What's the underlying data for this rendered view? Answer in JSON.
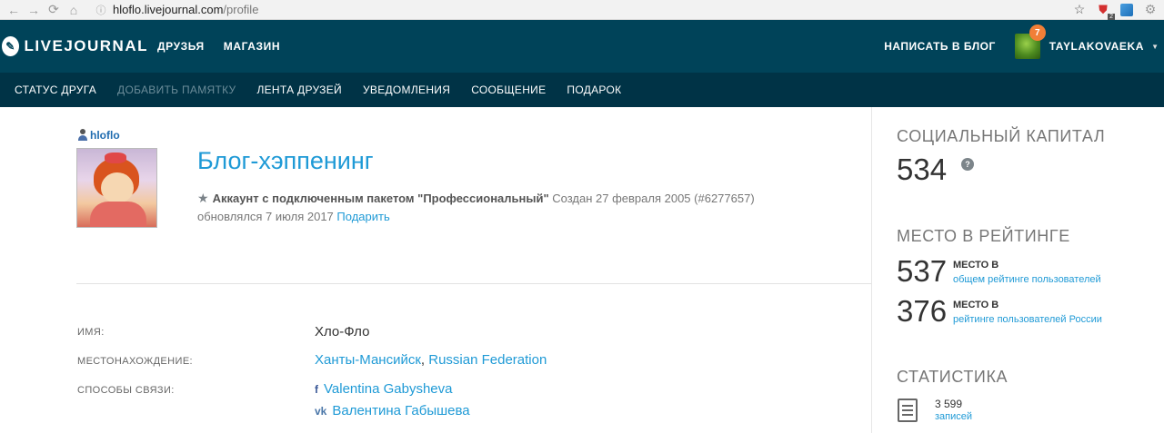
{
  "browser": {
    "url_host": "hloflo.livejournal.com",
    "url_path": "/profile",
    "shield_count": "2"
  },
  "topnav": {
    "logo_text": "LIVEJOURNAL",
    "links": [
      "ДРУЗЬЯ",
      "МАГАЗИН"
    ],
    "write_link": "НАПИСАТЬ В БЛОГ",
    "notif_count": "7",
    "username": "TAYLAKOVAEKA"
  },
  "subnav": {
    "items": [
      "СТАТУС ДРУГА",
      "ДОБАВИТЬ ПАМЯТКУ",
      "ЛЕНТА ДРУЗЕЙ",
      "УВЕДОМЛЕНИЯ",
      "СООБЩЕНИЕ",
      "ПОДАРОК"
    ]
  },
  "profile": {
    "username": "hloflo",
    "blog_title": "Блог-хэппенинг",
    "account_text": "Аккаунт с подключенным пакетом \"Профессиональный\"",
    "created_text": "Создан 27 февраля 2005 (#6277657)",
    "updated_text": "обновлялся 7 июля 2017",
    "gift_link": "Подарить",
    "rows": {
      "name_label": "ИМЯ:",
      "name_value": "Хло-Фло",
      "location_label": "МЕСТОНАХОЖДЕНИЕ:",
      "location_city": "Ханты-Мансийск",
      "location_country": "Russian Federation",
      "contacts_label": "СПОСОБЫ СВЯЗИ:",
      "contact_fb": "Valentina Gabysheva",
      "contact_vk": "Валентина Габышева"
    }
  },
  "sidebar": {
    "social_title": "СОЦИАЛЬНЫЙ КАПИТАЛ",
    "social_value": "534",
    "rating_title": "МЕСТО В РЕЙТИНГЕ",
    "rank1_value": "537",
    "rank1_label": "МЕСТО В",
    "rank1_link": "общем рейтинге пользователей",
    "rank2_value": "376",
    "rank2_label": "МЕСТО В",
    "rank2_link": "рейтинге пользователей России",
    "stats_title": "СТАТИСТИКА",
    "posts_count": "3 599",
    "posts_label": "записей"
  }
}
